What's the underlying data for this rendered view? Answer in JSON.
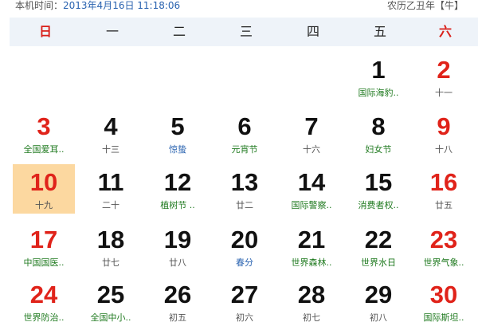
{
  "header": {
    "time_label": "本机时间：",
    "time_value": "2013年4月16日 11:18:06",
    "lunar_year": "农历乙丑年【牛】"
  },
  "weekdays": [
    "日",
    "一",
    "二",
    "三",
    "四",
    "五",
    "六"
  ],
  "weeks": [
    [
      null,
      null,
      null,
      null,
      null,
      {
        "day": "1",
        "sub": "国际海豹.."
      },
      {
        "day": "2",
        "sub": "十一"
      }
    ],
    [
      {
        "day": "3",
        "sub": "全国爱耳.."
      },
      {
        "day": "4",
        "sub": "十三"
      },
      {
        "day": "5",
        "sub": "惊蛰"
      },
      {
        "day": "6",
        "sub": "元宵节"
      },
      {
        "day": "7",
        "sub": "十六"
      },
      {
        "day": "8",
        "sub": "妇女节"
      },
      {
        "day": "9",
        "sub": "十八"
      }
    ],
    [
      {
        "day": "10",
        "sub": "十九"
      },
      {
        "day": "11",
        "sub": "二十"
      },
      {
        "day": "12",
        "sub": "植树节 .."
      },
      {
        "day": "13",
        "sub": "廿二"
      },
      {
        "day": "14",
        "sub": "国际警察.."
      },
      {
        "day": "15",
        "sub": "消费者权.."
      },
      {
        "day": "16",
        "sub": "廿五"
      }
    ],
    [
      {
        "day": "17",
        "sub": "中国国医.."
      },
      {
        "day": "18",
        "sub": "廿七"
      },
      {
        "day": "19",
        "sub": "廿八"
      },
      {
        "day": "20",
        "sub": "春分"
      },
      {
        "day": "21",
        "sub": "世界森林.."
      },
      {
        "day": "22",
        "sub": "世界水日"
      },
      {
        "day": "23",
        "sub": "世界气象.."
      }
    ],
    [
      {
        "day": "24",
        "sub": "世界防治.."
      },
      {
        "day": "25",
        "sub": "全国中小.."
      },
      {
        "day": "26",
        "sub": "初五"
      },
      {
        "day": "27",
        "sub": "初六"
      },
      {
        "day": "28",
        "sub": "初七"
      },
      {
        "day": "29",
        "sub": "初八"
      },
      {
        "day": "30",
        "sub": "国际斯坦.."
      }
    ]
  ],
  "today": "10",
  "colors": {
    "weekend_red": "#e0231a",
    "festival_green": "#1f7a1f",
    "solar_term_blue": "#2a63b0",
    "today_highlight": "#fcd8a0",
    "weekday_bar": "#eef3f9"
  }
}
